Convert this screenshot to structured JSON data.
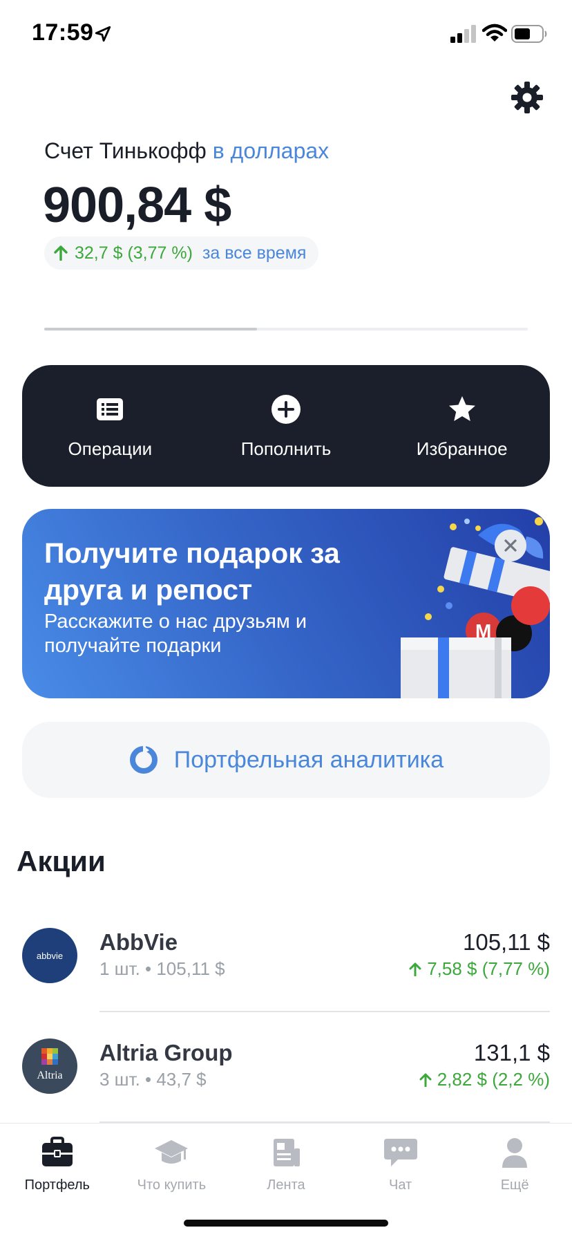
{
  "status_bar": {
    "time": "17:59"
  },
  "account": {
    "title": "Счет Тинькофф",
    "currency": "в долларах",
    "balance": "900,84 $",
    "change_value": "32,7 $ (3,77 %)",
    "change_period": "за все время",
    "progress_fraction": 0.44
  },
  "actions": [
    {
      "label": "Операции",
      "icon": "list-icon"
    },
    {
      "label": "Пополнить",
      "icon": "plus-circle-icon"
    },
    {
      "label": "Избранное",
      "icon": "star-icon"
    }
  ],
  "promo": {
    "title": "Получите подарок за друга и репост",
    "subtitle": "Расскажите о нас друзьям и получайте подарки"
  },
  "analytics": {
    "label": "Портфельная аналитика",
    "icon": "pie-chart-icon"
  },
  "stocks_section": {
    "title": "Акции",
    "items": [
      {
        "name": "AbbVie",
        "logo_text": "abbvie",
        "qty": "1 шт. • 105,11 $",
        "price": "105,11 $",
        "change": "7,58 $ (7,77 %)"
      },
      {
        "name": "Altria Group",
        "logo_text": "Altria",
        "qty": "3 шт. • 43,7 $",
        "price": "131,1 $",
        "change": "2,82 $ (2,2 %)"
      }
    ]
  },
  "tabbar": [
    {
      "label": "Портфель",
      "icon": "briefcase-icon",
      "active": true
    },
    {
      "label": "Что купить",
      "icon": "graduation-cap-icon",
      "active": false
    },
    {
      "label": "Лента",
      "icon": "newspaper-icon",
      "active": false
    },
    {
      "label": "Чат",
      "icon": "chat-bubble-icon",
      "active": false
    },
    {
      "label": "Ещё",
      "icon": "user-icon",
      "active": false
    }
  ],
  "colors": {
    "accent": "#4a86d9",
    "positive": "#3ca83c",
    "dark_panel": "#1a1f2b"
  }
}
